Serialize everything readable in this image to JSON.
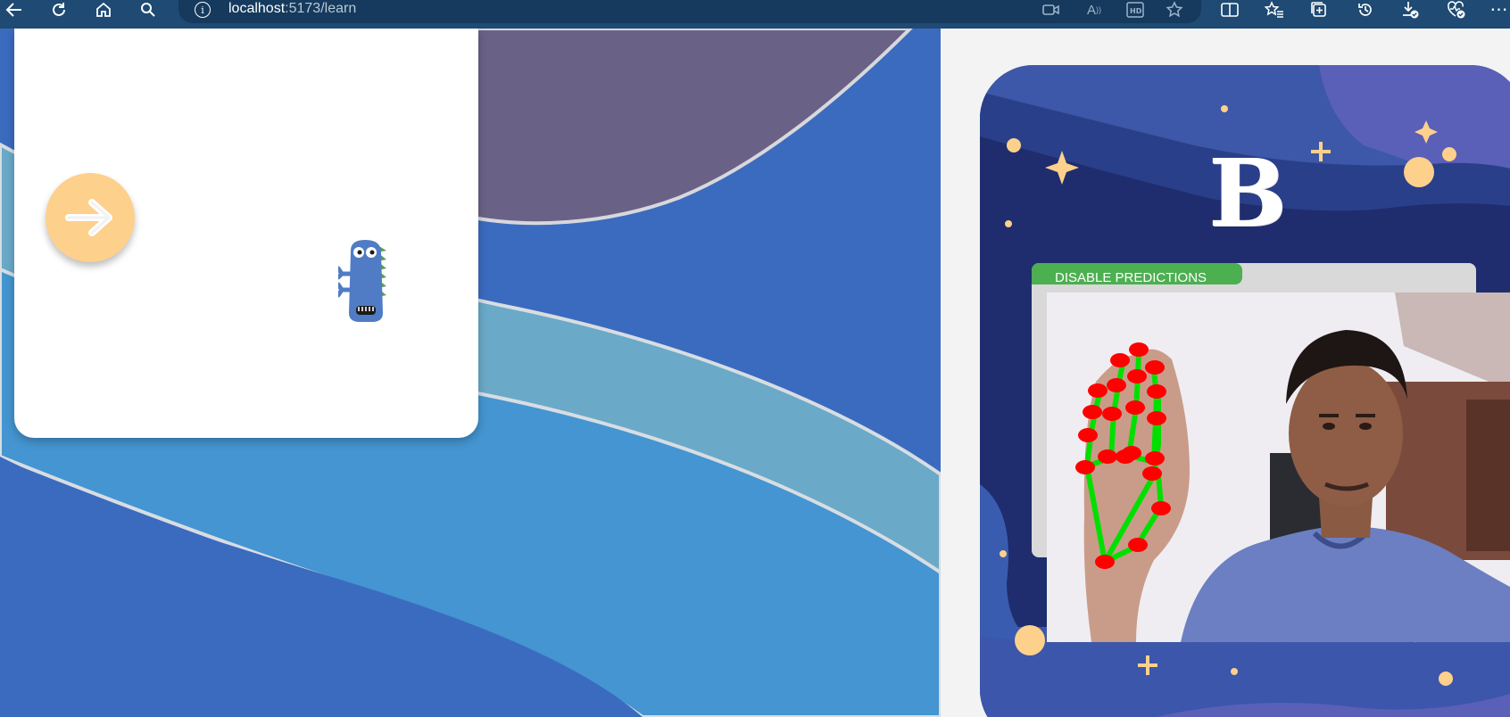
{
  "browser": {
    "url_host": "localhost",
    "url_rest": ":5173/learn",
    "toolbar_icons": [
      "back-icon",
      "reload-icon",
      "home-icon",
      "search-icon",
      "info-icon",
      "video-icon",
      "read-aloud-icon",
      "hd-icon",
      "favorite-star-icon",
      "split-screen-icon",
      "favorites-icon",
      "collections-icon",
      "history-icon",
      "downloads-icon",
      "browser-essentials-icon",
      "more-icon"
    ]
  },
  "lesson": {
    "current_letter": "B",
    "prediction_toggle_label": "DISABLE PREDICTIONS"
  },
  "colors": {
    "toolbar": "#1e4a73",
    "next_button": "#fdd08c",
    "toggle_green": "#4caf50",
    "landmark_point": "#ff0000",
    "landmark_line": "#00e000"
  }
}
